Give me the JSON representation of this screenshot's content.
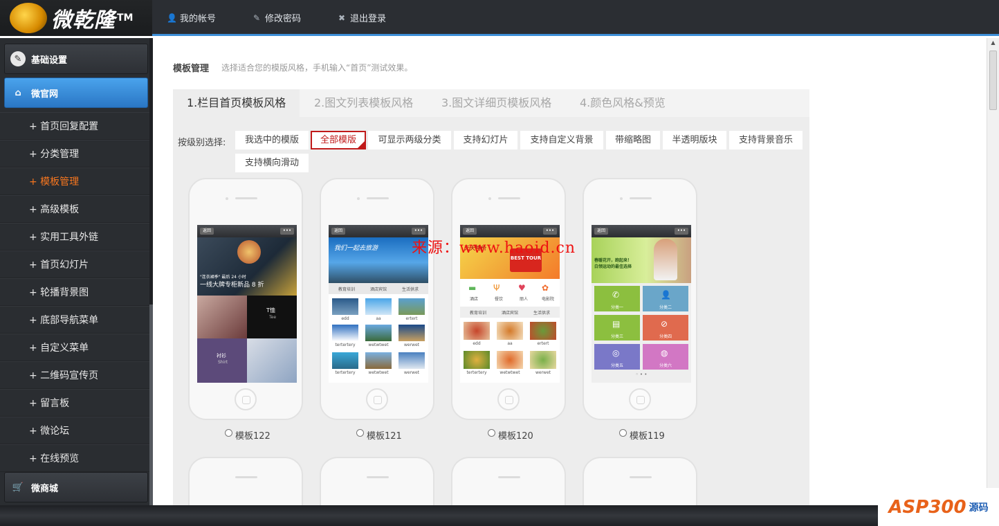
{
  "header": {
    "logo_text": "微乾隆",
    "logo_tm": "TM",
    "links": [
      {
        "label": "我的帐号",
        "icon": "user-icon"
      },
      {
        "label": "修改密码",
        "icon": "edit-icon"
      },
      {
        "label": "退出登录",
        "icon": "close-icon"
      }
    ]
  },
  "sidebar": {
    "groups": [
      {
        "label": "基础设置",
        "icon": "wrench-icon"
      },
      {
        "label": "微官网",
        "icon": "home-icon"
      },
      {
        "label": "微商城",
        "icon": "cart-icon"
      }
    ],
    "items": [
      {
        "label": "+ 首页回复配置"
      },
      {
        "label": "+ 分类管理"
      },
      {
        "label": "+ 模板管理"
      },
      {
        "label": "+ 高级模板"
      },
      {
        "label": "+ 实用工具外链"
      },
      {
        "label": "+ 首页幻灯片"
      },
      {
        "label": "+ 轮播背景图"
      },
      {
        "label": "+ 底部导航菜单"
      },
      {
        "label": "+ 自定义菜单"
      },
      {
        "label": "+ 二维码宣传页"
      },
      {
        "label": "+ 留言板"
      },
      {
        "label": "+ 微论坛"
      },
      {
        "label": "+ 在线预览"
      }
    ],
    "active_item": "+ 模板管理"
  },
  "page": {
    "title": "模板管理",
    "subtitle": "选择适合您的模版风格，手机输入“首页”测试效果。"
  },
  "tabs": [
    {
      "label": "1.栏目首页模板风格"
    },
    {
      "label": "2.图文列表模板风格"
    },
    {
      "label": "3.图文详细页模板风格"
    },
    {
      "label": "4.颜色风格&预览"
    }
  ],
  "filter": {
    "label": "按级别选择:",
    "chips": [
      {
        "label": "我选中的模版"
      },
      {
        "label": "全部模版"
      },
      {
        "label": "可显示两级分类"
      },
      {
        "label": "支持幻灯片"
      },
      {
        "label": "支持自定义背景"
      },
      {
        "label": "带缩略图"
      },
      {
        "label": "半透明版块"
      },
      {
        "label": "支持背景音乐"
      },
      {
        "label": "支持横向滑动"
      }
    ],
    "active_chip": "全部模版"
  },
  "templates": [
    {
      "name": "模板122",
      "nav_back": "返回",
      "nav_more": "•••",
      "hero_text1": "\"连衣裙季\" 最后 24 小时",
      "hero_text2": "一线大牌专柜新品 8 折",
      "tile_a": "T恤",
      "tile_a_sub": "Tee",
      "tile_b": "衬衫",
      "tile_b_sub": "Shirt"
    },
    {
      "name": "模板121",
      "nav_back": "返回",
      "nav_more": "•••",
      "banner": "我们一起去旅游",
      "tabs": [
        "教育培训",
        "酒店宾馆",
        "生活供求"
      ],
      "grid": [
        "edd",
        "aa",
        "ertert",
        "tertertery",
        "wetwtwet",
        "werwet",
        "tertertery",
        "wetwtwet",
        "werwet"
      ]
    },
    {
      "name": "模板120",
      "nav_back": "返回",
      "nav_more": "•••",
      "banner": "天天特价",
      "banner_tag": "BEST TOUR",
      "icons": [
        "酒店",
        "餐饮",
        "丽人",
        "电影院"
      ],
      "tabs": [
        "教育培训",
        "酒店宾馆",
        "生活供求"
      ],
      "grid": [
        "edd",
        "aa",
        "ertert",
        "tertertery",
        "wetwtwet",
        "werwet"
      ]
    },
    {
      "name": "模板119",
      "nav_back": "返回",
      "nav_more": "•••",
      "banner": "春暖花开，跑起来！",
      "banner2": "白领运动的最佳选择",
      "tiles": [
        "分类一",
        "分类二",
        "分类三",
        "分类四",
        "分类五",
        "分类六"
      ]
    }
  ],
  "colors": {
    "accent": "#3d8fd8",
    "active_menu": "#f7761f",
    "chip_active": "#c01a1a",
    "tile_green": "#8cbf3f",
    "tile_blue": "#6aa6c9",
    "tile_red": "#e06a4e",
    "tile_purple": "#7a78c8",
    "tile_pink": "#d277c4"
  },
  "overlay": {
    "watermark": "来源：www.haoid.cn",
    "site_logo": "ASP300",
    "site_logo_suffix": "源码"
  }
}
